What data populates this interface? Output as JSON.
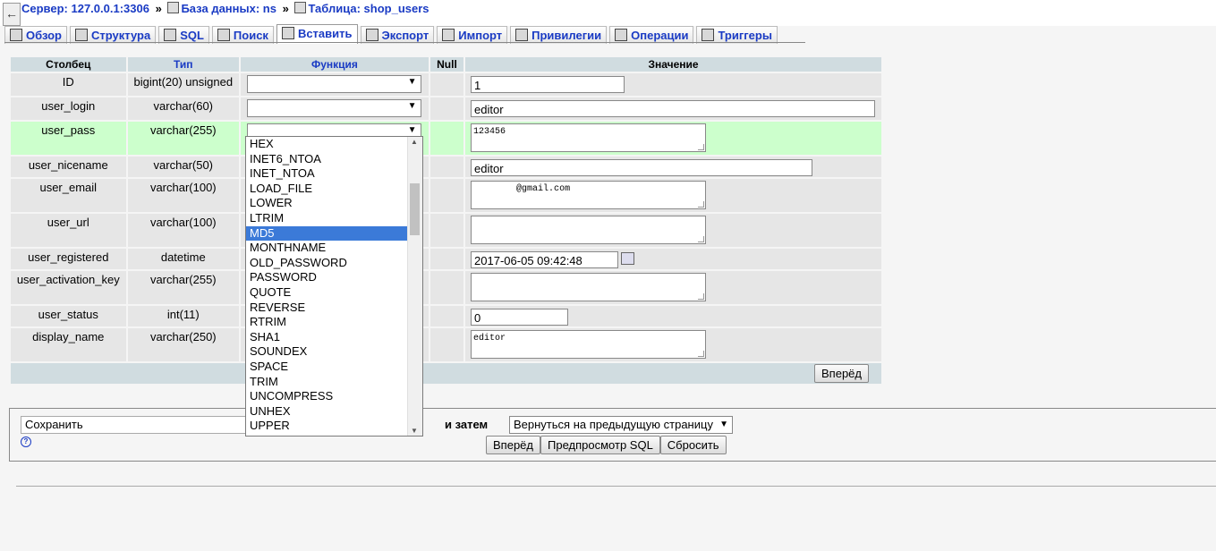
{
  "breadcrumb": {
    "server": "Сервер: 127.0.0.1:3306",
    "database": "База данных: ns",
    "table": "Таблица: shop_users",
    "separator": "»"
  },
  "tabs": [
    {
      "label": "Обзор",
      "icon": "browse-icon"
    },
    {
      "label": "Структура",
      "icon": "structure-icon"
    },
    {
      "label": "SQL",
      "icon": "sql-icon"
    },
    {
      "label": "Поиск",
      "icon": "search-icon"
    },
    {
      "label": "Вставить",
      "icon": "insert-icon",
      "active": true
    },
    {
      "label": "Экспорт",
      "icon": "export-icon"
    },
    {
      "label": "Импорт",
      "icon": "import-icon"
    },
    {
      "label": "Привилегии",
      "icon": "privileges-icon"
    },
    {
      "label": "Операции",
      "icon": "operations-icon"
    },
    {
      "label": "Триггеры",
      "icon": "triggers-icon"
    }
  ],
  "table": {
    "headers": {
      "column": "Столбец",
      "type": "Тип",
      "function": "Функция",
      "null": "Null",
      "value": "Значение"
    },
    "rows": [
      {
        "column": "ID",
        "type": "bigint(20) unsigned",
        "value": "1",
        "kind": "input"
      },
      {
        "column": "user_login",
        "type": "varchar(60)",
        "value": "editor",
        "kind": "input"
      },
      {
        "column": "user_pass",
        "type": "varchar(255)",
        "value": "123456",
        "kind": "textarea"
      },
      {
        "column": "user_nicename",
        "type": "varchar(50)",
        "value": "editor",
        "kind": "input"
      },
      {
        "column": "user_email",
        "type": "varchar(100)",
        "value": "        @gmail.com",
        "kind": "textarea"
      },
      {
        "column": "user_url",
        "type": "varchar(100)",
        "value": "",
        "kind": "textarea"
      },
      {
        "column": "user_registered",
        "type": "datetime",
        "value": "2017-06-05 09:42:48",
        "kind": "date"
      },
      {
        "column": "user_activation_key",
        "type": "varchar(255)",
        "value": "",
        "kind": "textarea"
      },
      {
        "column": "user_status",
        "type": "int(11)",
        "value": "0",
        "kind": "input"
      },
      {
        "column": "display_name",
        "type": "varchar(250)",
        "value": "editor",
        "kind": "textarea"
      }
    ],
    "go_label": "Вперёд"
  },
  "function_dropdown": {
    "items": [
      "HEX",
      "INET6_NTOA",
      "INET_NTOA",
      "LOAD_FILE",
      "LOWER",
      "LTRIM",
      "MD5",
      "MONTHNAME",
      "OLD_PASSWORD",
      "PASSWORD",
      "QUOTE",
      "REVERSE",
      "RTRIM",
      "SHA1",
      "SOUNDEX",
      "SPACE",
      "TRIM",
      "UNCOMPRESS",
      "UNHEX",
      "UPPER"
    ],
    "selected": "MD5"
  },
  "bottom": {
    "save_option": "Сохранить",
    "then_label": "и затем",
    "after_option": "Вернуться на предыдущую страницу",
    "go_label": "Вперёд",
    "preview_label": "Предпросмотр SQL",
    "reset_label": "Сбросить",
    "help": "?"
  },
  "colors": {
    "link": "#1a3bc4",
    "highlight_row": "#ccffcc",
    "header_bg": "#d0dce0",
    "selection": "#3b7ad8"
  }
}
